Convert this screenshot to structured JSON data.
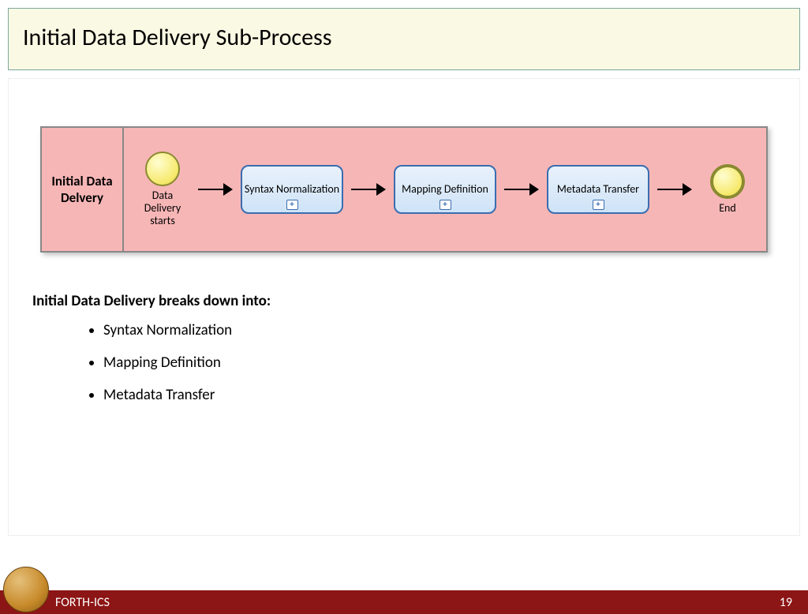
{
  "title": "Initial Data Delivery Sub-Process",
  "diagram": {
    "lane": "Initial Data Delvery",
    "start": {
      "label": "Data Delivery starts"
    },
    "steps": [
      {
        "label": "Syntax Normalization"
      },
      {
        "label": "Mapping Definition"
      },
      {
        "label": "Metadata Transfer"
      }
    ],
    "end": {
      "label": "End"
    }
  },
  "body": {
    "lead": "Initial Data Delivery breaks down into:",
    "items": [
      "Syntax Normalization",
      "Mapping Definition",
      "Metadata Transfer"
    ]
  },
  "footer": {
    "org": "FORTH-ICS",
    "page": "19"
  }
}
